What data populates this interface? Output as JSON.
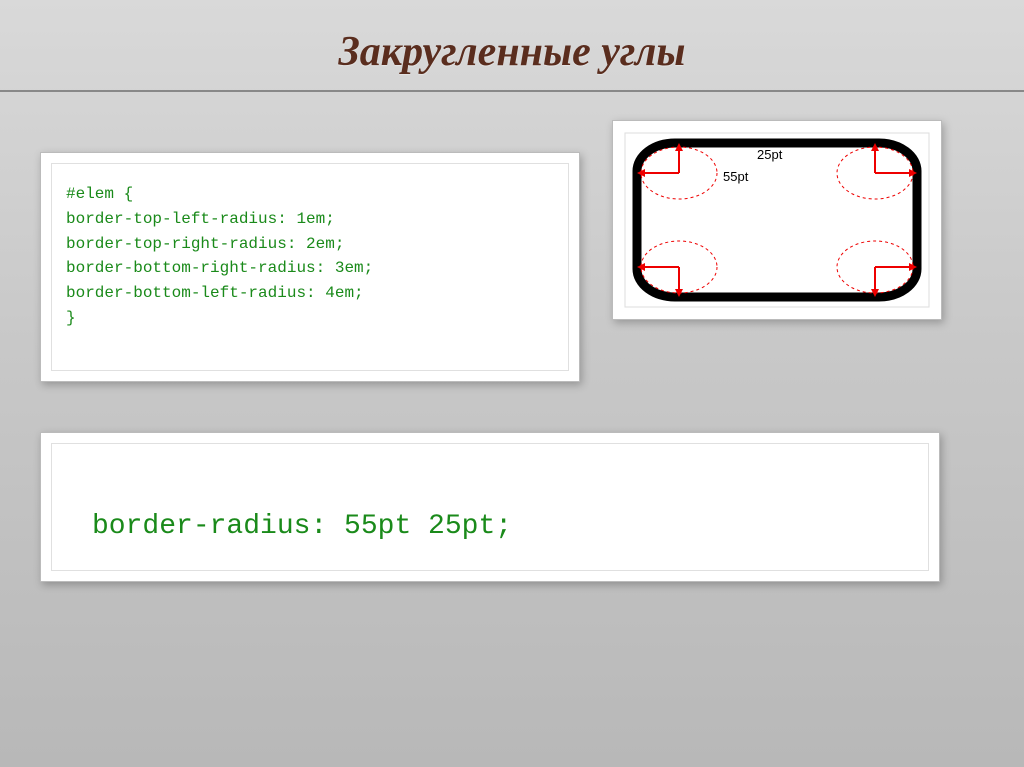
{
  "title": "Закругленные углы",
  "code_block": {
    "line1": "#elem {",
    "line2": "    border-top-left-radius: 1em;",
    "line3": "    border-top-right-radius: 2em;",
    "line4": "    border-bottom-right-radius: 3em;",
    "line5": "    border-bottom-left-radius: 4em;",
    "line6": "}"
  },
  "diagram": {
    "label_top": "25pt",
    "label_side": "55pt"
  },
  "shorthand": "border-radius: 55pt 25pt;"
}
